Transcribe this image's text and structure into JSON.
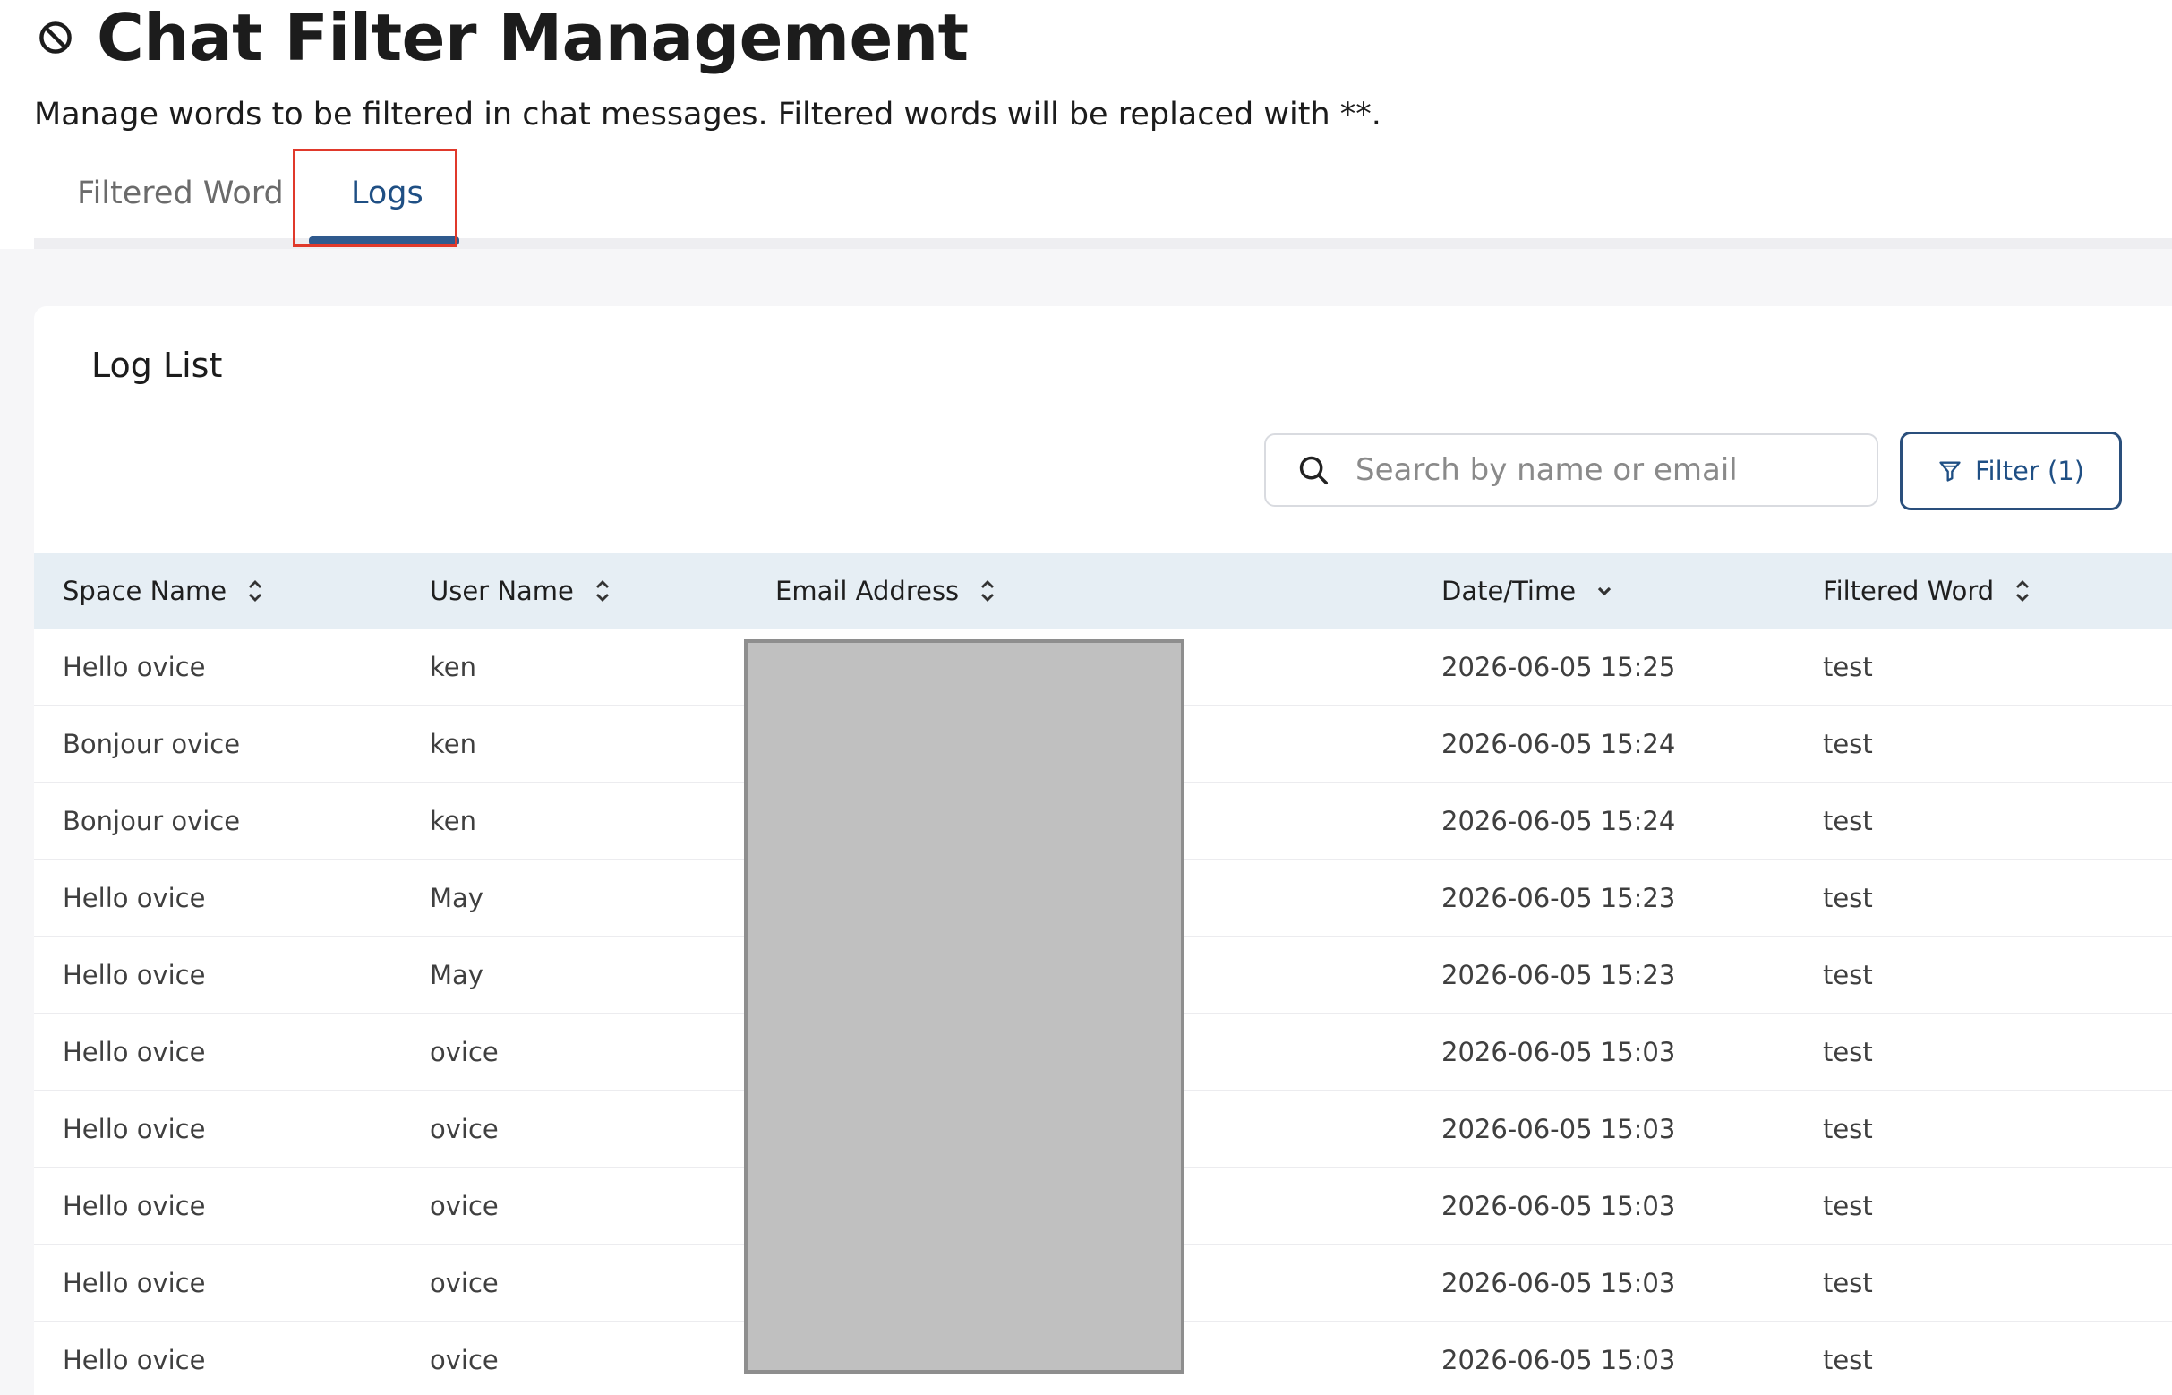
{
  "header": {
    "title": "Chat Filter Management",
    "title_icon": "block-icon",
    "subtitle": "Manage words to be filtered in chat messages. Filtered words will be replaced with **."
  },
  "tabs": [
    {
      "label": "Filtered Word",
      "active": false
    },
    {
      "label": "Logs",
      "active": true
    }
  ],
  "log_list": {
    "title": "Log List",
    "search": {
      "placeholder": "Search by name or email",
      "value": ""
    },
    "filter_button": {
      "label": "Filter (1)",
      "icon": "funnel-icon"
    },
    "columns": [
      {
        "label": "Space Name",
        "sort_icon": "sort-updown-icon"
      },
      {
        "label": "User Name",
        "sort_icon": "sort-updown-icon"
      },
      {
        "label": "Email Address",
        "sort_icon": "sort-updown-icon"
      },
      {
        "label": "Date/Time",
        "sort_icon": "sort-desc-icon"
      },
      {
        "label": "Filtered Word",
        "sort_icon": "sort-updown-icon"
      }
    ],
    "rows": [
      {
        "space": "Hello ovice",
        "user": "ken",
        "datetime": "2026-06-05 15:25",
        "word": "test"
      },
      {
        "space": "Bonjour ovice",
        "user": "ken",
        "datetime": "2026-06-05 15:24",
        "word": "test"
      },
      {
        "space": "Bonjour ovice",
        "user": "ken",
        "datetime": "2026-06-05 15:24",
        "word": "test"
      },
      {
        "space": "Hello ovice",
        "user": "May",
        "datetime": "2026-06-05 15:23",
        "word": "test"
      },
      {
        "space": "Hello ovice",
        "user": "May",
        "datetime": "2026-06-05 15:23",
        "word": "test"
      },
      {
        "space": "Hello ovice",
        "user": "ovice",
        "datetime": "2026-06-05 15:03",
        "word": "test"
      },
      {
        "space": "Hello ovice",
        "user": "ovice",
        "datetime": "2026-06-05 15:03",
        "word": "test"
      },
      {
        "space": "Hello ovice",
        "user": "ovice",
        "datetime": "2026-06-05 15:03",
        "word": "test"
      },
      {
        "space": "Hello ovice",
        "user": "ovice",
        "datetime": "2026-06-05 15:03",
        "word": "test"
      },
      {
        "space": "Hello ovice",
        "user": "ovice",
        "datetime": "2026-06-05 15:03",
        "word": "test"
      }
    ]
  },
  "colors": {
    "accent": "#1f4f84",
    "highlight_border": "#e0392b",
    "table_header_bg": "#e6eef4",
    "page_bg": "#f6f6f8"
  }
}
